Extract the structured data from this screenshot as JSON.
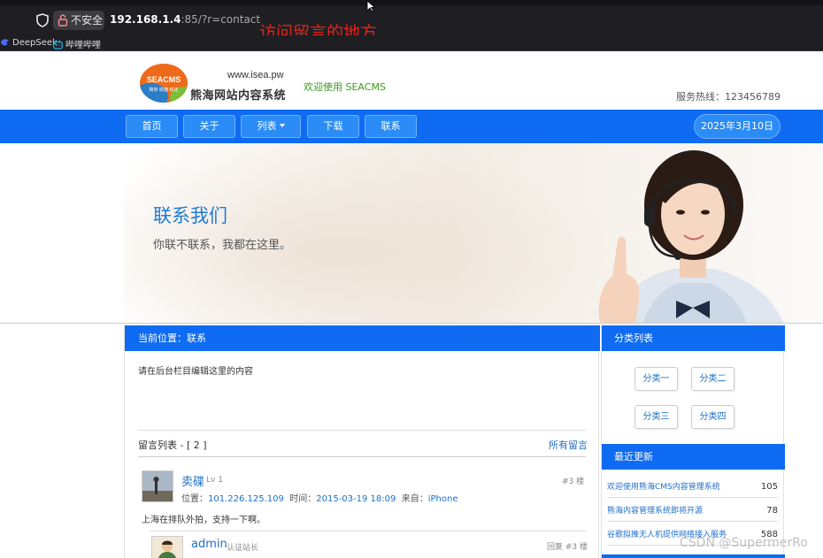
{
  "browser": {
    "insecure_label": "不安全",
    "url_host": "192.168.1.4",
    "url_port": ":85",
    "url_path": "/?r=contact",
    "annotation": "访问留言的地方",
    "bookmarks": [
      {
        "label": "DeepSeek",
        "icon": "deepseek-icon"
      },
      {
        "label": "哔哩哔哩",
        "icon": "bilibili-icon"
      }
    ]
  },
  "header": {
    "logo_text": "SEACMS",
    "logo_tagline": "简单·快捷·稳定",
    "domain": "www.isea.pw",
    "site_name": "熊海网站内容系统",
    "welcome": "欢迎使用 SEACMS",
    "hotline": "服务热线：123456789"
  },
  "nav": {
    "items": [
      {
        "label": "首页"
      },
      {
        "label": "关于"
      },
      {
        "label": "列表"
      },
      {
        "label": "下载"
      },
      {
        "label": "联系"
      }
    ],
    "date": "2025年3月10日"
  },
  "banner": {
    "title": "联系我们",
    "subtitle": "你联不联系，我都在这里。"
  },
  "main": {
    "breadcrumb": "当前位置：联系",
    "content": "请在后台栏目编辑这里的内容",
    "comments_title": "留言列表 - [ 2 ]",
    "all_comments": "所有留言",
    "comment1": {
      "name": "卖碟",
      "level": "Lv 1",
      "floor": "#3 楼",
      "ip_label": "位置：",
      "ip": "101.226.125.109",
      "time_label": "时间：",
      "time": "2015-03-19 18:09",
      "from_label": "来自：",
      "from": "iPhone",
      "text": "上海在排队外拍，支持一下啊。"
    },
    "comment2": {
      "name": "admin",
      "level": "认证站长",
      "floor": "回复 #3 楼"
    }
  },
  "sidebar": {
    "categories_title": "分类列表",
    "categories": [
      {
        "label": "分类一"
      },
      {
        "label": "分类二"
      },
      {
        "label": "分类三"
      },
      {
        "label": "分类四"
      }
    ],
    "updates_title": "最近更新",
    "updates": [
      {
        "title": "欢迎使用熊海CMS内容管理系统",
        "count": "105"
      },
      {
        "title": "熊海内容管理系统即将开源",
        "count": "78"
      },
      {
        "title": "谷歌拟推无人机提供网络接入服务",
        "count": "588"
      }
    ]
  },
  "watermark": "CSDN @SupermerRo",
  "colors": {
    "nav_blue": "#0f6bf2",
    "link_blue": "#1e6fc8",
    "annotation_red": "#e4231b",
    "welcome_green": "#3a9a1c"
  }
}
